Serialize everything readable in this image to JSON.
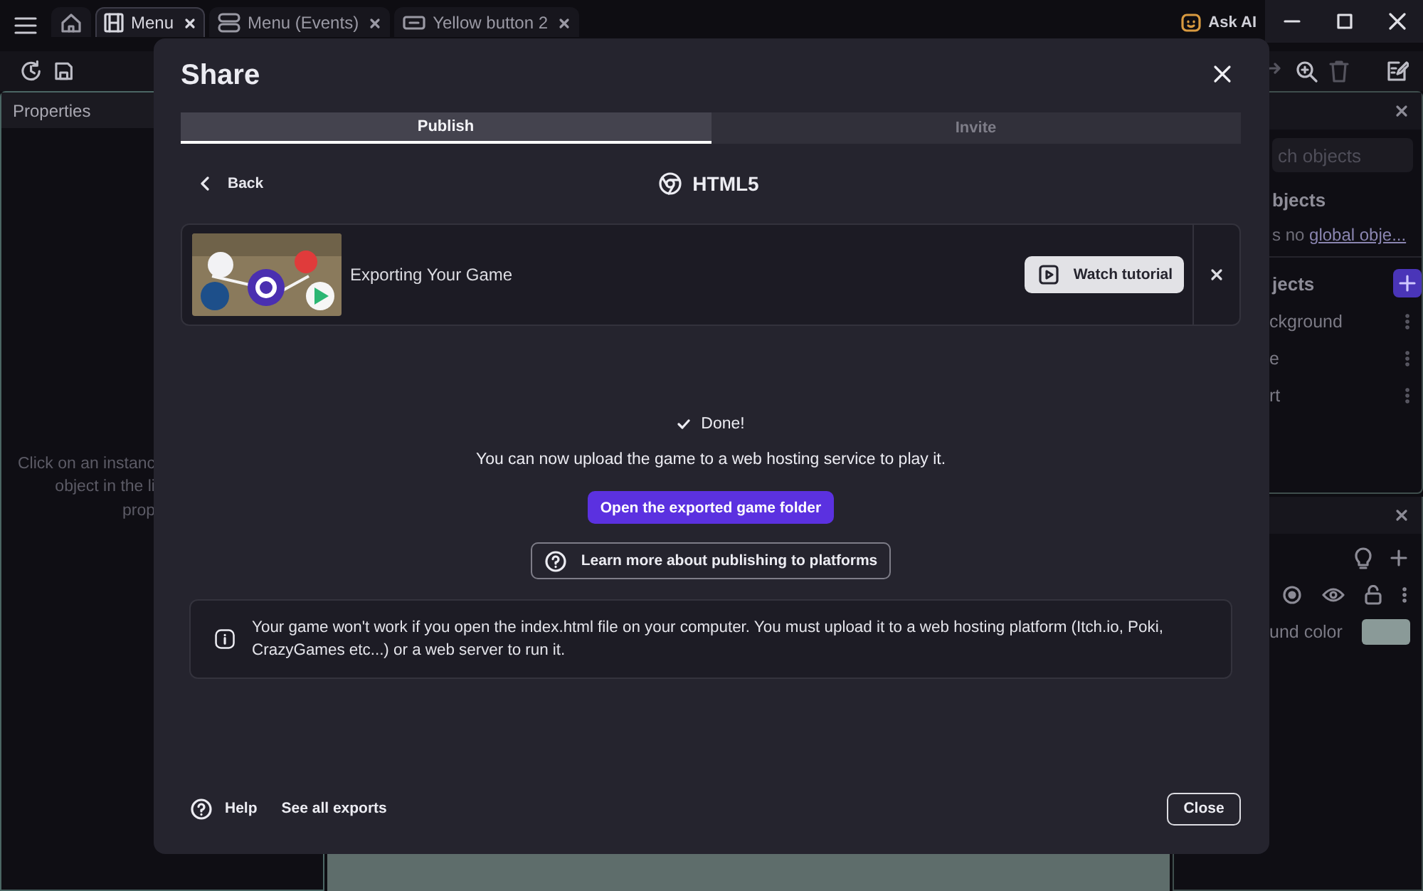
{
  "app_tabs": [
    {
      "kind": "home",
      "selected": false
    },
    {
      "kind": "scene",
      "label": "Menu",
      "selected": true
    },
    {
      "kind": "events",
      "label": "Menu (Events)",
      "selected": false
    },
    {
      "kind": "object",
      "label": "Yellow button 2",
      "selected": false
    }
  ],
  "ask_ai": {
    "label": "Ask AI"
  },
  "properties_panel": {
    "title": "Properties",
    "message_lines": [
      "Click on an instanc",
      "object in the li",
      "prop"
    ]
  },
  "objects_panel": {
    "search": {
      "placeholder": "ch objects"
    },
    "global_heading": "bjects",
    "global_empty_prefix": "s no",
    "global_empty_link": "global obje...",
    "scene_heading": "jects",
    "items": [
      "ckground",
      "e",
      "rt"
    ]
  },
  "layers_panel": {
    "background_label": "und color"
  },
  "dialog": {
    "title": "Share",
    "tabs": [
      {
        "label": "Publish",
        "selected": true
      },
      {
        "label": "Invite",
        "selected": false
      }
    ],
    "back": "Back",
    "platform": "HTML5",
    "tutorial": {
      "title": "Exporting Your Game",
      "button": "Watch tutorial"
    },
    "status": "Done!",
    "message": "You can now upload the game to a web hosting service to play it.",
    "primary_button": "Open the exported game folder",
    "learn_button": "Learn more about publishing to platforms",
    "notice": "Your game won't work if you open the index.html file on your computer. You must upload it to a web hosting platform (Itch.io, Poki, CrazyGames etc...) or a web server to run it.",
    "help": "Help",
    "see_all": "See all exports",
    "close": "Close"
  }
}
